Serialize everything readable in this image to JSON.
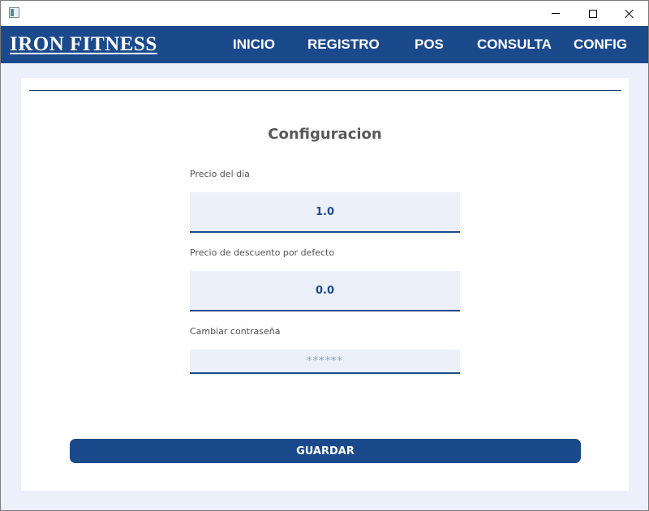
{
  "window": {
    "icon": "app-window-icon",
    "controls": {
      "minimize_icon": "minimize-icon",
      "maximize_icon": "maximize-icon",
      "close_icon": "close-icon"
    }
  },
  "navbar": {
    "brand": "IRON FITNESS",
    "items": [
      "INICIO",
      "REGISTRO",
      "POS",
      "CONSULTA",
      "CONFIG"
    ],
    "background": "#1b4a8c"
  },
  "form": {
    "title": "Configuracion",
    "fields": [
      {
        "label": "Precio del dia",
        "value": "1.0"
      },
      {
        "label": "Precio de descuento por defecto",
        "value": "0.0"
      },
      {
        "label": "Cambiar contraseña",
        "value": "",
        "placeholder": "******"
      }
    ],
    "save_label": "GUARDAR"
  },
  "colors": {
    "accent": "#1b4a8c",
    "content_background": "#ecf0fb",
    "title_text": "#595959"
  }
}
